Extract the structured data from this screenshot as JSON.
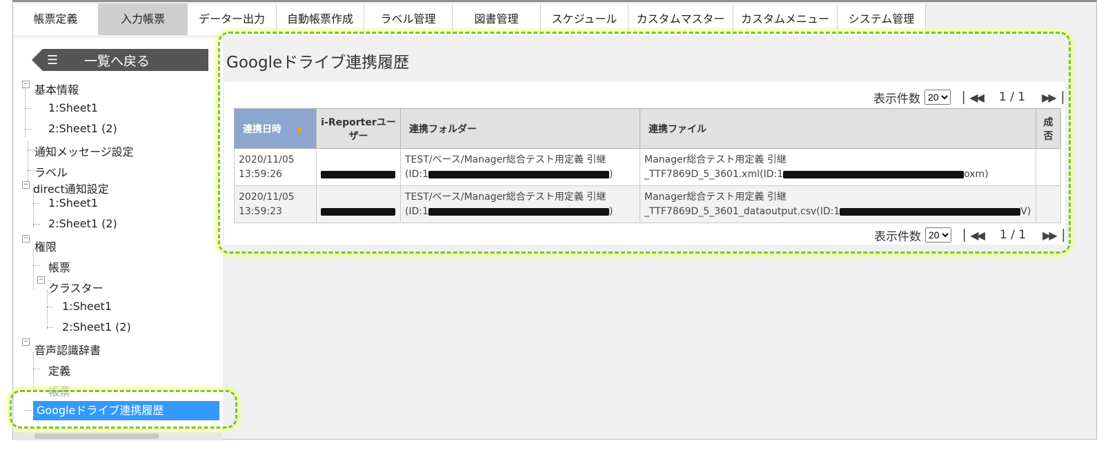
{
  "nav": {
    "tabs": [
      {
        "label": "帳票定義",
        "active": false
      },
      {
        "label": "入力帳票",
        "active": true
      },
      {
        "label": "データー出力",
        "active": false
      },
      {
        "label": "自動帳票作成",
        "active": false
      },
      {
        "label": "ラベル管理",
        "active": false
      },
      {
        "label": "図書管理",
        "active": false
      },
      {
        "label": "スケジュール",
        "active": false
      },
      {
        "label": "カスタムマスター",
        "active": false
      },
      {
        "label": "カスタムメニュー",
        "active": false
      },
      {
        "label": "システム管理",
        "active": false
      }
    ]
  },
  "sidebar": {
    "back_label": "一覧へ戻る",
    "back_icon": "list-icon",
    "tree": [
      {
        "label": "基本情報"
      },
      {
        "label": "1:Sheet1"
      },
      {
        "label": "2:Sheet1 (2)"
      },
      {
        "label": "通知メッセージ設定"
      },
      {
        "label": "ラベル"
      },
      {
        "label": "direct通知設定"
      },
      {
        "label": "1:Sheet1"
      },
      {
        "label": "2:Sheet1 (2)"
      },
      {
        "label": "権限"
      },
      {
        "label": "帳票"
      },
      {
        "label": "クラスター"
      },
      {
        "label": "1:Sheet1"
      },
      {
        "label": "2:Sheet1 (2)"
      },
      {
        "label": "音声認識辞書"
      },
      {
        "label": "定義"
      },
      {
        "label": "帳票"
      }
    ],
    "selected_label": "Googleドライブ連携履歴"
  },
  "main": {
    "title": "Googleドライブ連携履歴",
    "pager_top": {
      "count_label": "表示件数",
      "page_size": "20",
      "page_display": "1 / 1"
    },
    "pager_bottom": {
      "count_label": "表示件数",
      "page_size": "20",
      "page_display": "1 / 1"
    },
    "table": {
      "headers": [
        "連携日時",
        "i-Reporterユーザー",
        "連携フォルダー",
        "連携ファイル",
        "成否"
      ],
      "sort_column": "連携日時",
      "rows": [
        {
          "date": "2020/11/05",
          "time": "13:59:26",
          "folder_line1": "TEST/ベース/Manager総合テスト用定義 引継",
          "folder_line2_start": "(ID:1",
          "folder_line2_end": ")",
          "file_line1": "Manager総合テスト用定義 引継",
          "file_line2_start": "_TTF7869D_5_3601.xml(ID:1",
          "file_line2_end": "oxm)",
          "result": ""
        },
        {
          "date": "2020/11/05",
          "time": "13:59:23",
          "folder_line1": "TEST/ベース/Manager総合テスト用定義 引継",
          "folder_line2_start": "(ID:1",
          "folder_line2_end": ")",
          "file_line1": "Manager総合テスト用定義 引継",
          "file_line2_start": "_TTF7869D_5_3601_dataoutput.csv(ID:1",
          "file_line2_end": "V)",
          "result": ""
        }
      ]
    }
  },
  "colors": {
    "accent_highlight": "#7fc41d",
    "selected_bg": "#3399ff",
    "sorted_header": "#8ca6ce",
    "sort_arrow": "#f3a300"
  }
}
